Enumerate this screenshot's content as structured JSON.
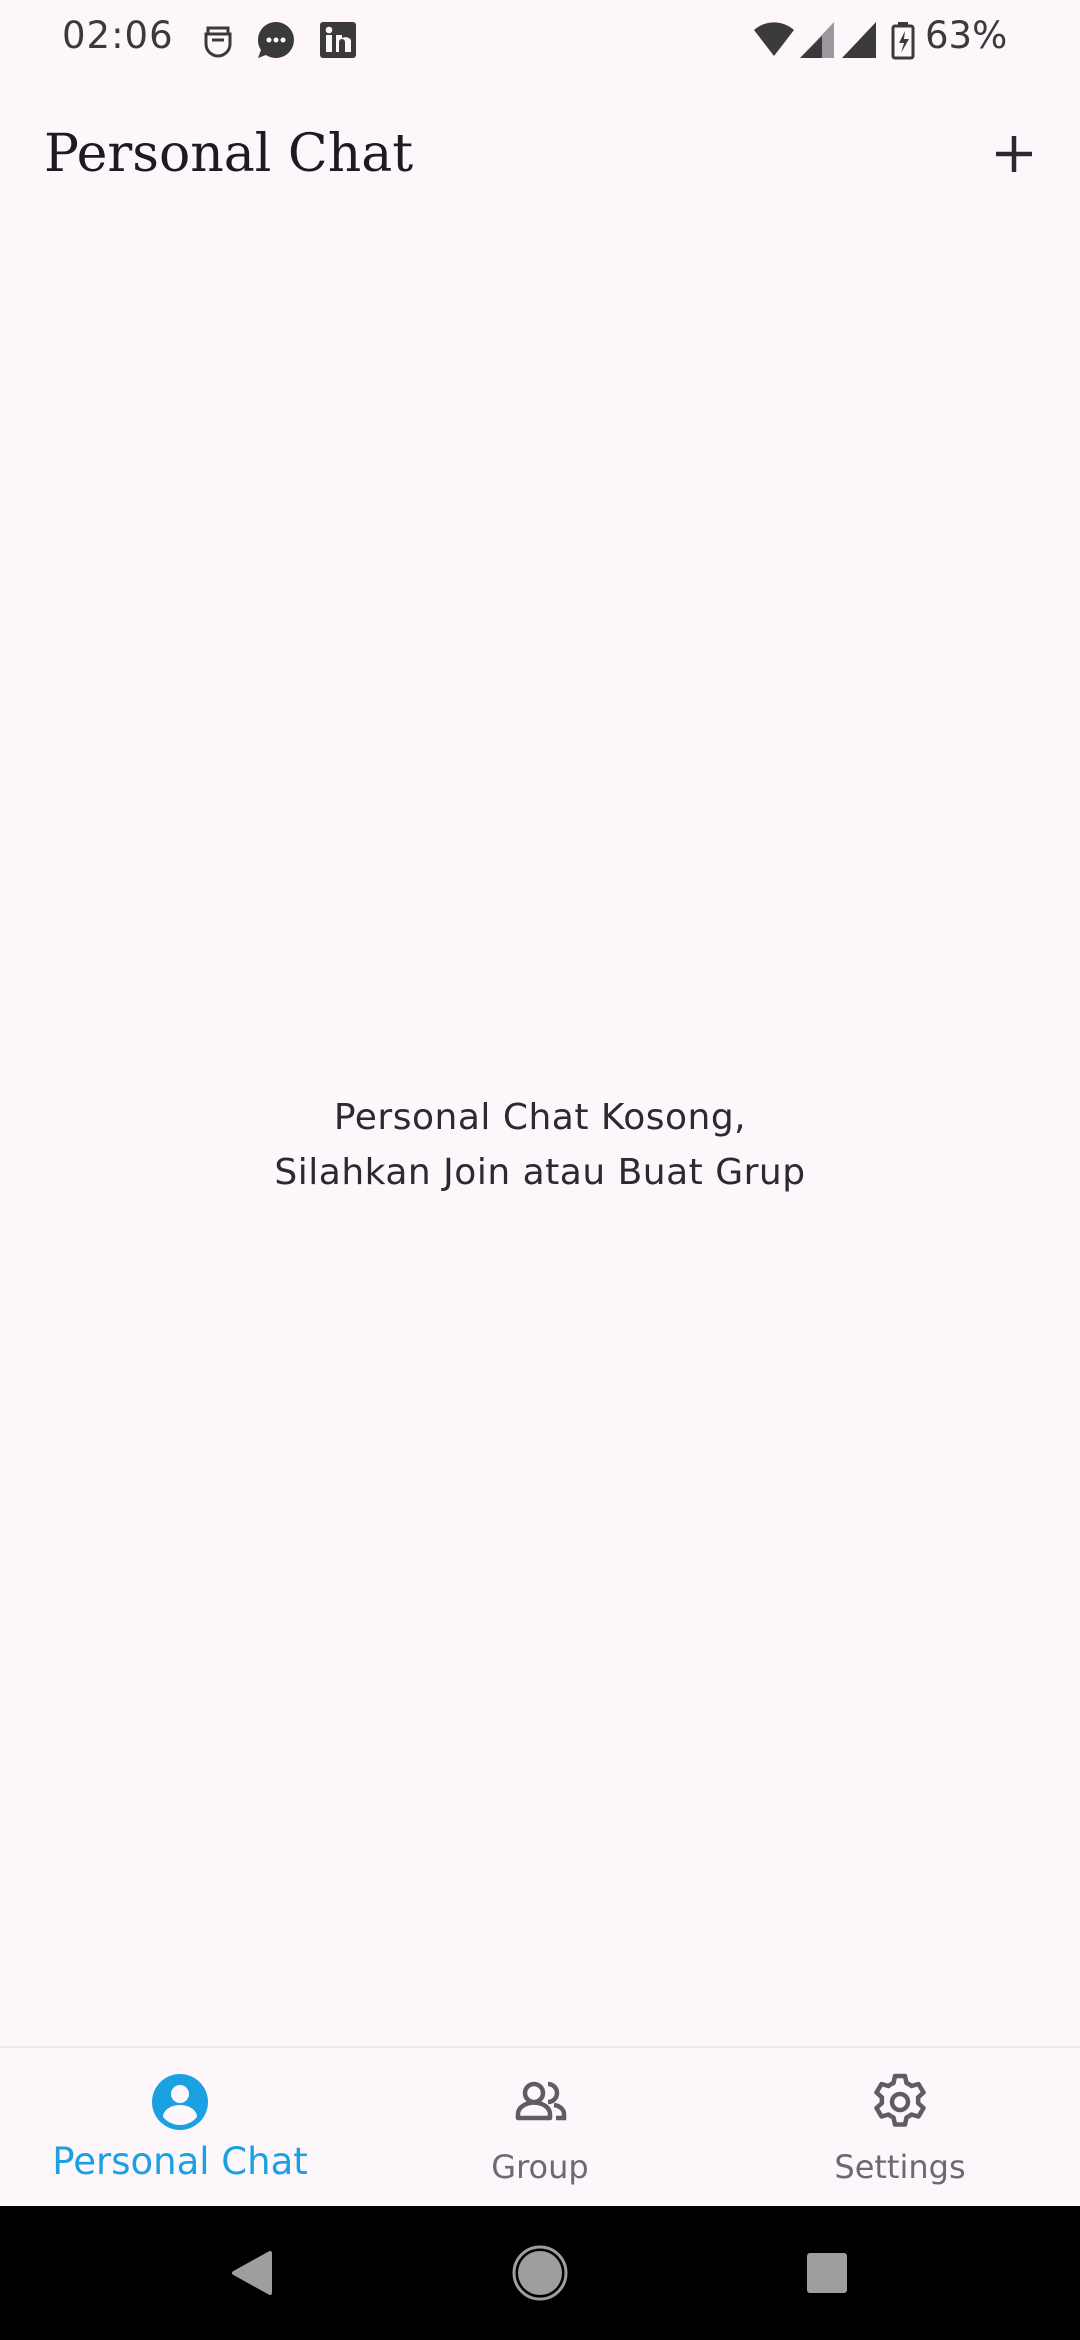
{
  "status_bar": {
    "time": "02:06",
    "battery": "63%",
    "notification_icons": [
      "usb-debug-icon",
      "messages-icon",
      "linkedin-icon"
    ],
    "system_icons": [
      "wifi-icon",
      "signal-icon",
      "signal-icon",
      "battery-charging-icon"
    ]
  },
  "app_bar": {
    "title": "Personal Chat",
    "action_icon": "add-icon"
  },
  "empty_state": {
    "line1": "Personal Chat Kosong,",
    "line2": "Silahkan Join atau Buat Grup"
  },
  "bottom_nav": {
    "items": [
      {
        "label": "Personal Chat",
        "icon": "person-icon",
        "active": true
      },
      {
        "label": "Group",
        "icon": "group-icon",
        "active": false
      },
      {
        "label": "Settings",
        "icon": "gear-icon",
        "active": false
      }
    ]
  },
  "colors": {
    "background": "#FDF7FC",
    "accent": "#1BA1E2",
    "inactive": "#6B6A70",
    "text": "#1C1B1F"
  },
  "system_nav": {
    "buttons": [
      "back-icon",
      "home-icon",
      "recents-icon"
    ]
  }
}
